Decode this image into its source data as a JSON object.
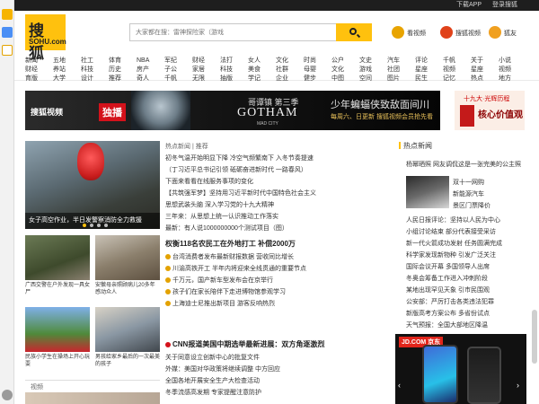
{
  "topbar": {
    "download_app": "下载APP",
    "login": "登录搜狐"
  },
  "logo": {
    "title": "搜 狐",
    "url": "SOHU.com"
  },
  "search": {
    "placeholder": "大家都在搜：雷神探险家（游戏"
  },
  "header_links": [
    {
      "label": "看视频",
      "color": "#e8a400"
    },
    {
      "label": "搜狐视频",
      "color": "#e0421a"
    },
    {
      "label": "狐友",
      "color": "#f0a020"
    }
  ],
  "nav": {
    "row1": [
      "新闻",
      "五地",
      "社工",
      "体育",
      "NBA",
      "军纪",
      "财经",
      "法打",
      "女人",
      "文化",
      "时尚",
      "公户",
      "文史",
      "汽车",
      "评论",
      "千帆",
      "关于",
      "小说"
    ],
    "row2": [
      "财经",
      "养站",
      "科技",
      "历史",
      "房产",
      "子公",
      "家居",
      "科技",
      "美食",
      "社群",
      "母婴",
      "文化",
      "游戏",
      "社团",
      "星座",
      "视频",
      "星座",
      "视频"
    ],
    "row3": [
      "育版",
      "大学",
      "设计",
      "推荐",
      "奇人",
      "千帆",
      "无限",
      "抽版",
      "学记",
      "企业",
      "健步",
      "中图",
      "空间",
      "图片",
      "民生",
      "记忆",
      "热点",
      "地方"
    ]
  },
  "banner": {
    "brand": "搜狐视频",
    "tag": "独播",
    "title_cn": "哥谭镇 第三季",
    "title_en": "GOTHAM",
    "sub_en": "MAD CITY",
    "tagline": "少年蝙蝠侠致敌面间川",
    "schedule": "每周六、日更新 搜狐视频会员抢先看"
  },
  "right_ad": {
    "line1": "十九大·光辉历程",
    "line2": "核心价值观"
  },
  "hero": {
    "caption": "女子高空作业，半日发警察消防全力救援"
  },
  "dots": 4,
  "thumbs": [
    {
      "caption": "广西交警在户外发现一具女尸"
    },
    {
      "caption": "安徽母亲照顾病儿20多年 感动众人"
    },
    {
      "caption": "民族小学生在操场上开心玩耍"
    },
    {
      "caption": "男孩给家乡最后的一次最美的孩子"
    }
  ],
  "section_label": "视频",
  "center": {
    "tag": "热点新闻 | 推荐",
    "items": [
      "初冬气温开始明显下降 冷空气频繁南下 入冬节奏提速",
      "（丁习近平总书记引领 砥砺奋进新时代 一路春风）",
      "下面来看看在线服务事项的变化",
      "【共筑强军梦】坚持用习近平新时代中国特色社会主义",
      "思想武装头脑 深入学习党的十九大精神",
      "三年来：从思想上统一认识推动工作落实",
      "最新：有人说1000000000个测试项目（图）"
    ],
    "headline1": "权衡118名农民工在外地打工 补偿2000万",
    "list1": [
      "台湾消费者发布最新财报数据 营收同比增长",
      "川渝高铁开工 半年内将迎来全线贯通的重要节点",
      "千万元，国产新车型发布会在京举行",
      "孩子们在家长陪伴下走进博物馆参观学习",
      "上海迪士尼推出新项目 游客反响热烈"
    ],
    "headline2": "CNN报道美国中期选举最新进展：双方角逐激烈",
    "list2": [
      "关于同意设立创新中心的批复文件",
      "外媒：美国对华政策将继续调整 中方回应",
      "全国各地开展安全生产大检查活动",
      "冬季流感高发期 专家提醒注意防护"
    ]
  },
  "right": {
    "label": "热点新闻",
    "items": [
      "杨幂晒照 网友调侃这是一张完美的公主照",
      "人民日报评论：坚持以人民为中心",
      "小组讨论结束 部分代表接受采访",
      "新一代火箭成功发射 任务圆满完成",
      "科学家发现新物种 引发广泛关注",
      "国际会议开幕 多国领导人出席",
      "冬奥会筹备工作进入冲刺阶段",
      "某地出现罕见天象 引市民围观",
      "公安部：严厉打击各类违法犯罪",
      "新版高考方案公布 多省份试点",
      "天气预报：全国大部地区降温"
    ],
    "side_items": [
      "双十一网购",
      "新能源汽车",
      "景区门票降价"
    ]
  },
  "jd_ad": {
    "brand": "JD.COM 京东"
  }
}
